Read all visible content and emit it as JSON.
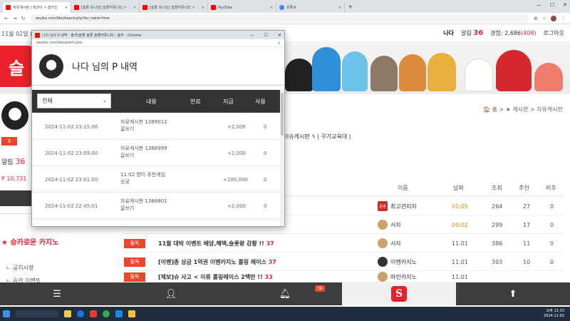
{
  "browser": {
    "tabs": [
      {
        "label": "자유게시판 | 회원이 > 슬카인",
        "icon": "red-s-favicon",
        "active": true
      },
      {
        "label": "[슬롯 유니언] 슬롯커뮤니티 >",
        "icon": "youtube-favicon",
        "active": false
      },
      {
        "label": "[슬롯 유니언] 슬롯커뮤니티 >",
        "icon": "youtube-favicon",
        "active": false
      },
      {
        "label": "YouTube",
        "icon": "youtube-favicon",
        "active": false
      },
      {
        "label": "유튜브",
        "icon": "globe-favicon",
        "active": false
      }
    ],
    "url": "seulka.com/bbs/board.php?bo_table=free"
  },
  "site": {
    "date": "11월 02일 (토)",
    "user_name": "나다",
    "alarm_label": "알림",
    "alarm_count": "36",
    "exp_label": "경험: 2,686",
    "exp_extra": "(408)",
    "logout": "로그아웃"
  },
  "sidebar": {
    "badge": "5",
    "alarm_label": "알림",
    "alarm_count": "36",
    "point": "P 10,731",
    "title": "★ 승카로운 카지노",
    "items": [
      "ㄴ 공지사항",
      "ㄴ 승카 이벤트"
    ]
  },
  "main": {
    "breadcrumb": "🏠 홈 > ★ 게시판 > 자유게시판",
    "categories": "이슈게시판 ϟ  |  쿠기교육대  |",
    "headers": {
      "name": "이름",
      "date": "날짜",
      "views": "조회",
      "recommend": "추천",
      "nonrec": "비추"
    },
    "rows": [
      {
        "tag": "",
        "title": "",
        "count": "",
        "name": "최고관리자",
        "date": "01:05",
        "views": "264",
        "rec": "27",
        "no": "0",
        "date_hl": true
      },
      {
        "tag": "",
        "title": "",
        "count": "",
        "name": "서자",
        "date": "00:02",
        "views": "299",
        "rec": "17",
        "no": "0",
        "date_hl": true
      },
      {
        "tag": "필독",
        "title": "11월 대박 이벤트 배당,혜택,슬롯왕 감황 !!",
        "count": "37",
        "name": "서자",
        "date": "11.01",
        "views": "386",
        "rec": "11",
        "no": "0",
        "date_hl": false
      },
      {
        "tag": "필독",
        "title": "[이벤]총 상금 1억권 이벤카지노 롤링 레이스",
        "count": "37",
        "name": "이벤카지노",
        "date": "11.01",
        "views": "393",
        "rec": "10",
        "no": "0",
        "date_hl": false
      },
      {
        "tag": "필독",
        "title": "[제보]슈 사고 < 이류 롤링레이스 2백만 !!",
        "count": "33",
        "name": "마린카지노",
        "date": "11.01",
        "views": "",
        "rec": "",
        "no": "",
        "date_hl": false
      }
    ]
  },
  "popup": {
    "title_bar": "나다 님의 P 내역 - 슬카(슬롯 슬롯 슬롯커뮤니티 - 슬카 - Chrome",
    "url": "seulka.com/bbs/point.php",
    "heading": "나다 님의 P 내역",
    "filter": "전체",
    "headers": {
      "content": "내용",
      "expire": "만료",
      "pay": "지급",
      "use": "사용"
    },
    "rows": [
      {
        "date": "2024-11-02 23:15:06",
        "content1": "자유게시판 1389012",
        "content2": "글쓰기",
        "amount": "+2,000",
        "use": "0"
      },
      {
        "date": "2024-11-02 23:09:00",
        "content1": "자유게시판 1388999",
        "content2": "글쓰기",
        "amount": "+2,000",
        "use": "0"
      },
      {
        "date": "2024-11-02 23:01:00",
        "content1": "11.02 향이 추천게임",
        "content2": "성공",
        "amount": "+200,000",
        "use": "0"
      },
      {
        "date": "2024-11-02 22:45:01",
        "content1": "자유게시판 1388801",
        "content2": "글쓰기",
        "amount": "+2,000",
        "use": "0"
      }
    ]
  },
  "bottomnav": {
    "notify_count": "36"
  },
  "taskbar": {
    "time": "오후 11:33",
    "date": "2024-11-02"
  },
  "colors": {
    "accent": "#e9462b",
    "dark": "#333333",
    "brand_red": "#e8212c"
  }
}
